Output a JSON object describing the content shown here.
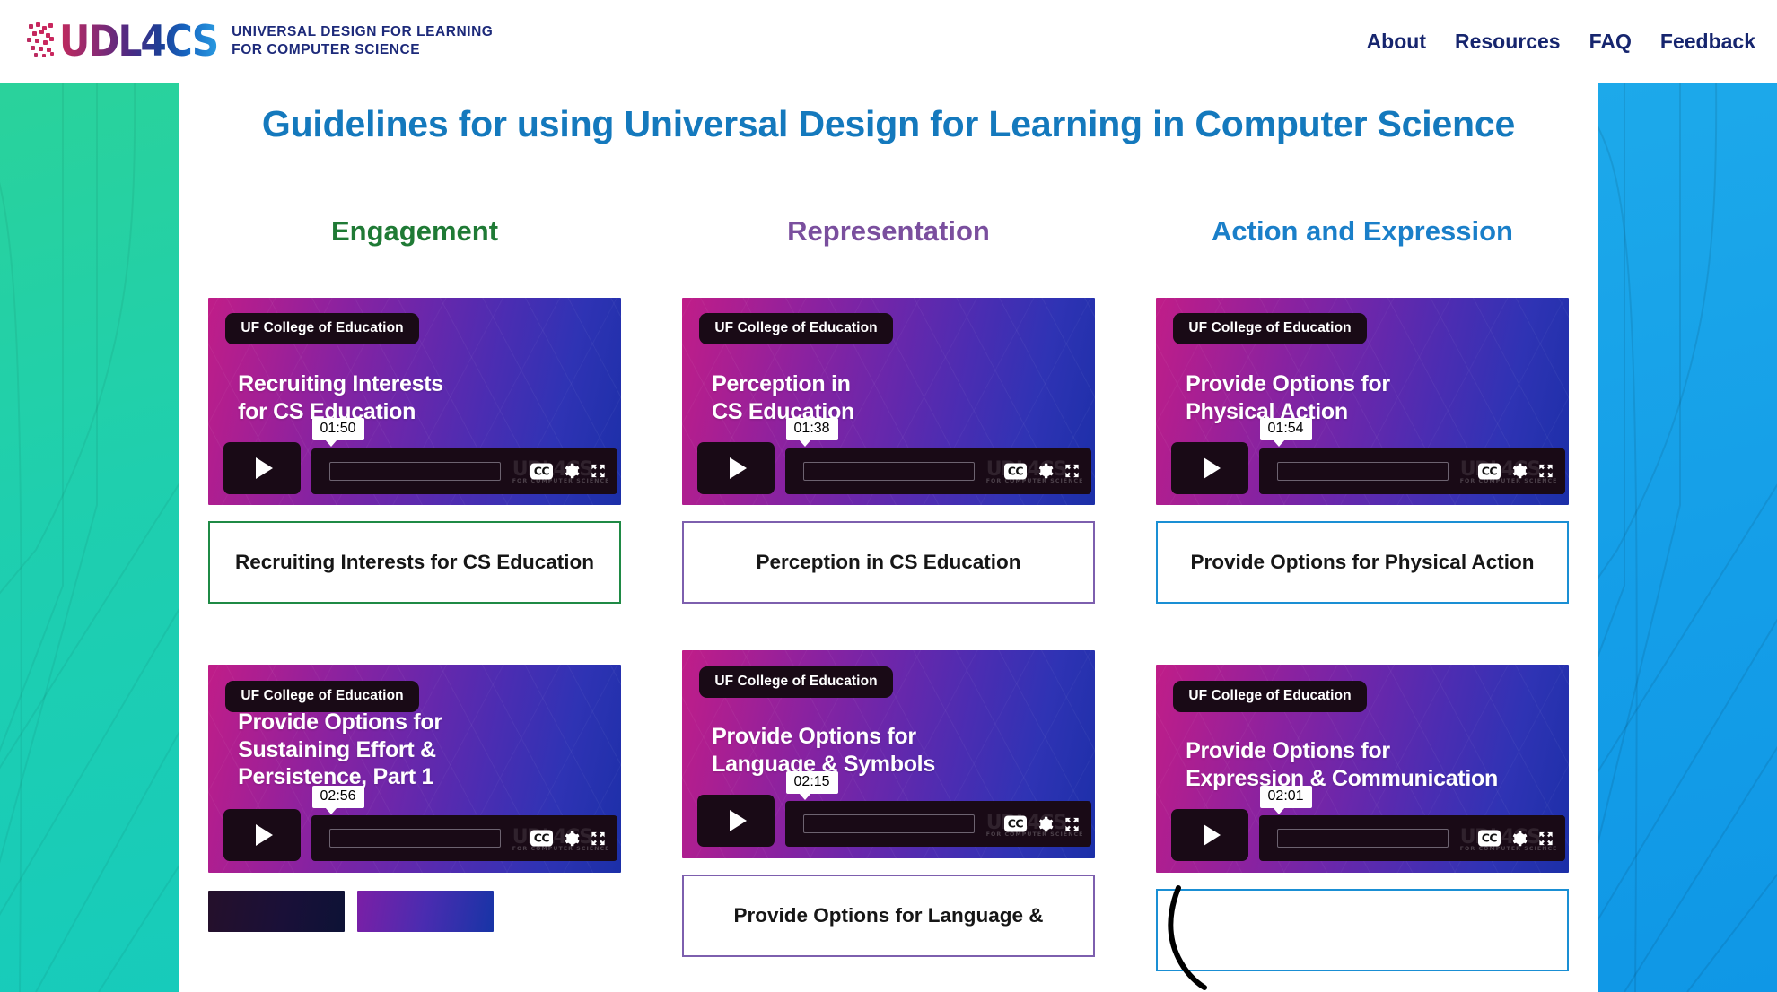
{
  "header": {
    "logo_word": "UDL4CS",
    "logo_tagline_line1": "Universal Design for Learning",
    "logo_tagline_line2": "for Computer Science",
    "nav": [
      {
        "label": "About"
      },
      {
        "label": "Resources"
      },
      {
        "label": "FAQ"
      },
      {
        "label": "Feedback"
      }
    ]
  },
  "main": {
    "page_title": "Guidelines for using Universal Design for Learning in Computer Science",
    "badge_text": "UF College of Education",
    "watermark": "UDL4CS",
    "watermark_sub": "FOR COMPUTER SCIENCE",
    "cc_label": "CC",
    "columns": [
      {
        "heading": "Engagement",
        "accent": "#1f7a35",
        "videos": [
          {
            "thumb_title": "Recruiting Interests\nfor CS Education",
            "duration": "01:50",
            "caption": "Recruiting Interests for CS Education"
          },
          {
            "thumb_title": "Provide Options for\nSustaining Effort &\nPersistence, Part 1",
            "duration": "02:56",
            "caption": ""
          }
        ]
      },
      {
        "heading": "Representation",
        "accent": "#7a4f9e",
        "videos": [
          {
            "thumb_title": "Perception in\nCS Education",
            "duration": "01:38",
            "caption": "Perception in CS Education"
          },
          {
            "thumb_title": "Provide Options for\nLanguage & Symbols",
            "duration": "02:15",
            "caption": "Provide Options for Language &"
          }
        ]
      },
      {
        "heading": "Action and Expression",
        "accent": "#1a8fd4",
        "videos": [
          {
            "thumb_title": "Provide Options for\nPhysical Action",
            "duration": "01:54",
            "caption": "Provide Options for Physical Action"
          },
          {
            "thumb_title": "Provide Options for\nExpression & Communication",
            "duration": "02:01",
            "caption": ""
          }
        ]
      }
    ]
  }
}
